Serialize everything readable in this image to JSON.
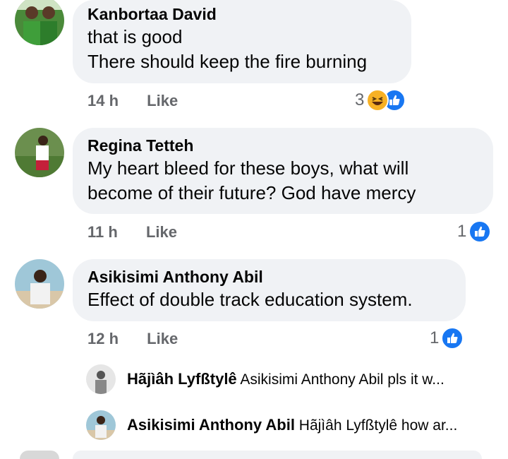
{
  "comments": [
    {
      "author": "Kanbortaa David",
      "text": "that is good\nThere should keep the fire burning",
      "time": "14 h",
      "like_label": "Like",
      "reaction_count": "3",
      "reactions": [
        "haha-icon",
        "like-icon"
      ]
    },
    {
      "author": "Regina Tetteh",
      "text": "My heart bleed for these boys, what will\nbecome of their future? God have mercy",
      "time": "11 h",
      "like_label": "Like",
      "reaction_count": "1",
      "reactions": [
        "like-icon"
      ]
    },
    {
      "author": "Asikisimi Anthony Abil",
      "text": "Effect of double track education system.",
      "time": "12 h",
      "like_label": "Like",
      "reaction_count": "1",
      "reactions": [
        "like-icon"
      ]
    }
  ],
  "replies": [
    {
      "author": "Hãjìâh Lyfßtylê",
      "preview": "Asikisimi Anthony Abil pls it w..."
    },
    {
      "author": "Asikisimi Anthony Abil",
      "preview": "Hãjìâh Lyfßtylê how ar..."
    }
  ],
  "colors": {
    "bubble": "#f0f2f5",
    "meta": "#65676b",
    "like_blue": "#1877f2",
    "haha_yellow": "#f7b125"
  }
}
